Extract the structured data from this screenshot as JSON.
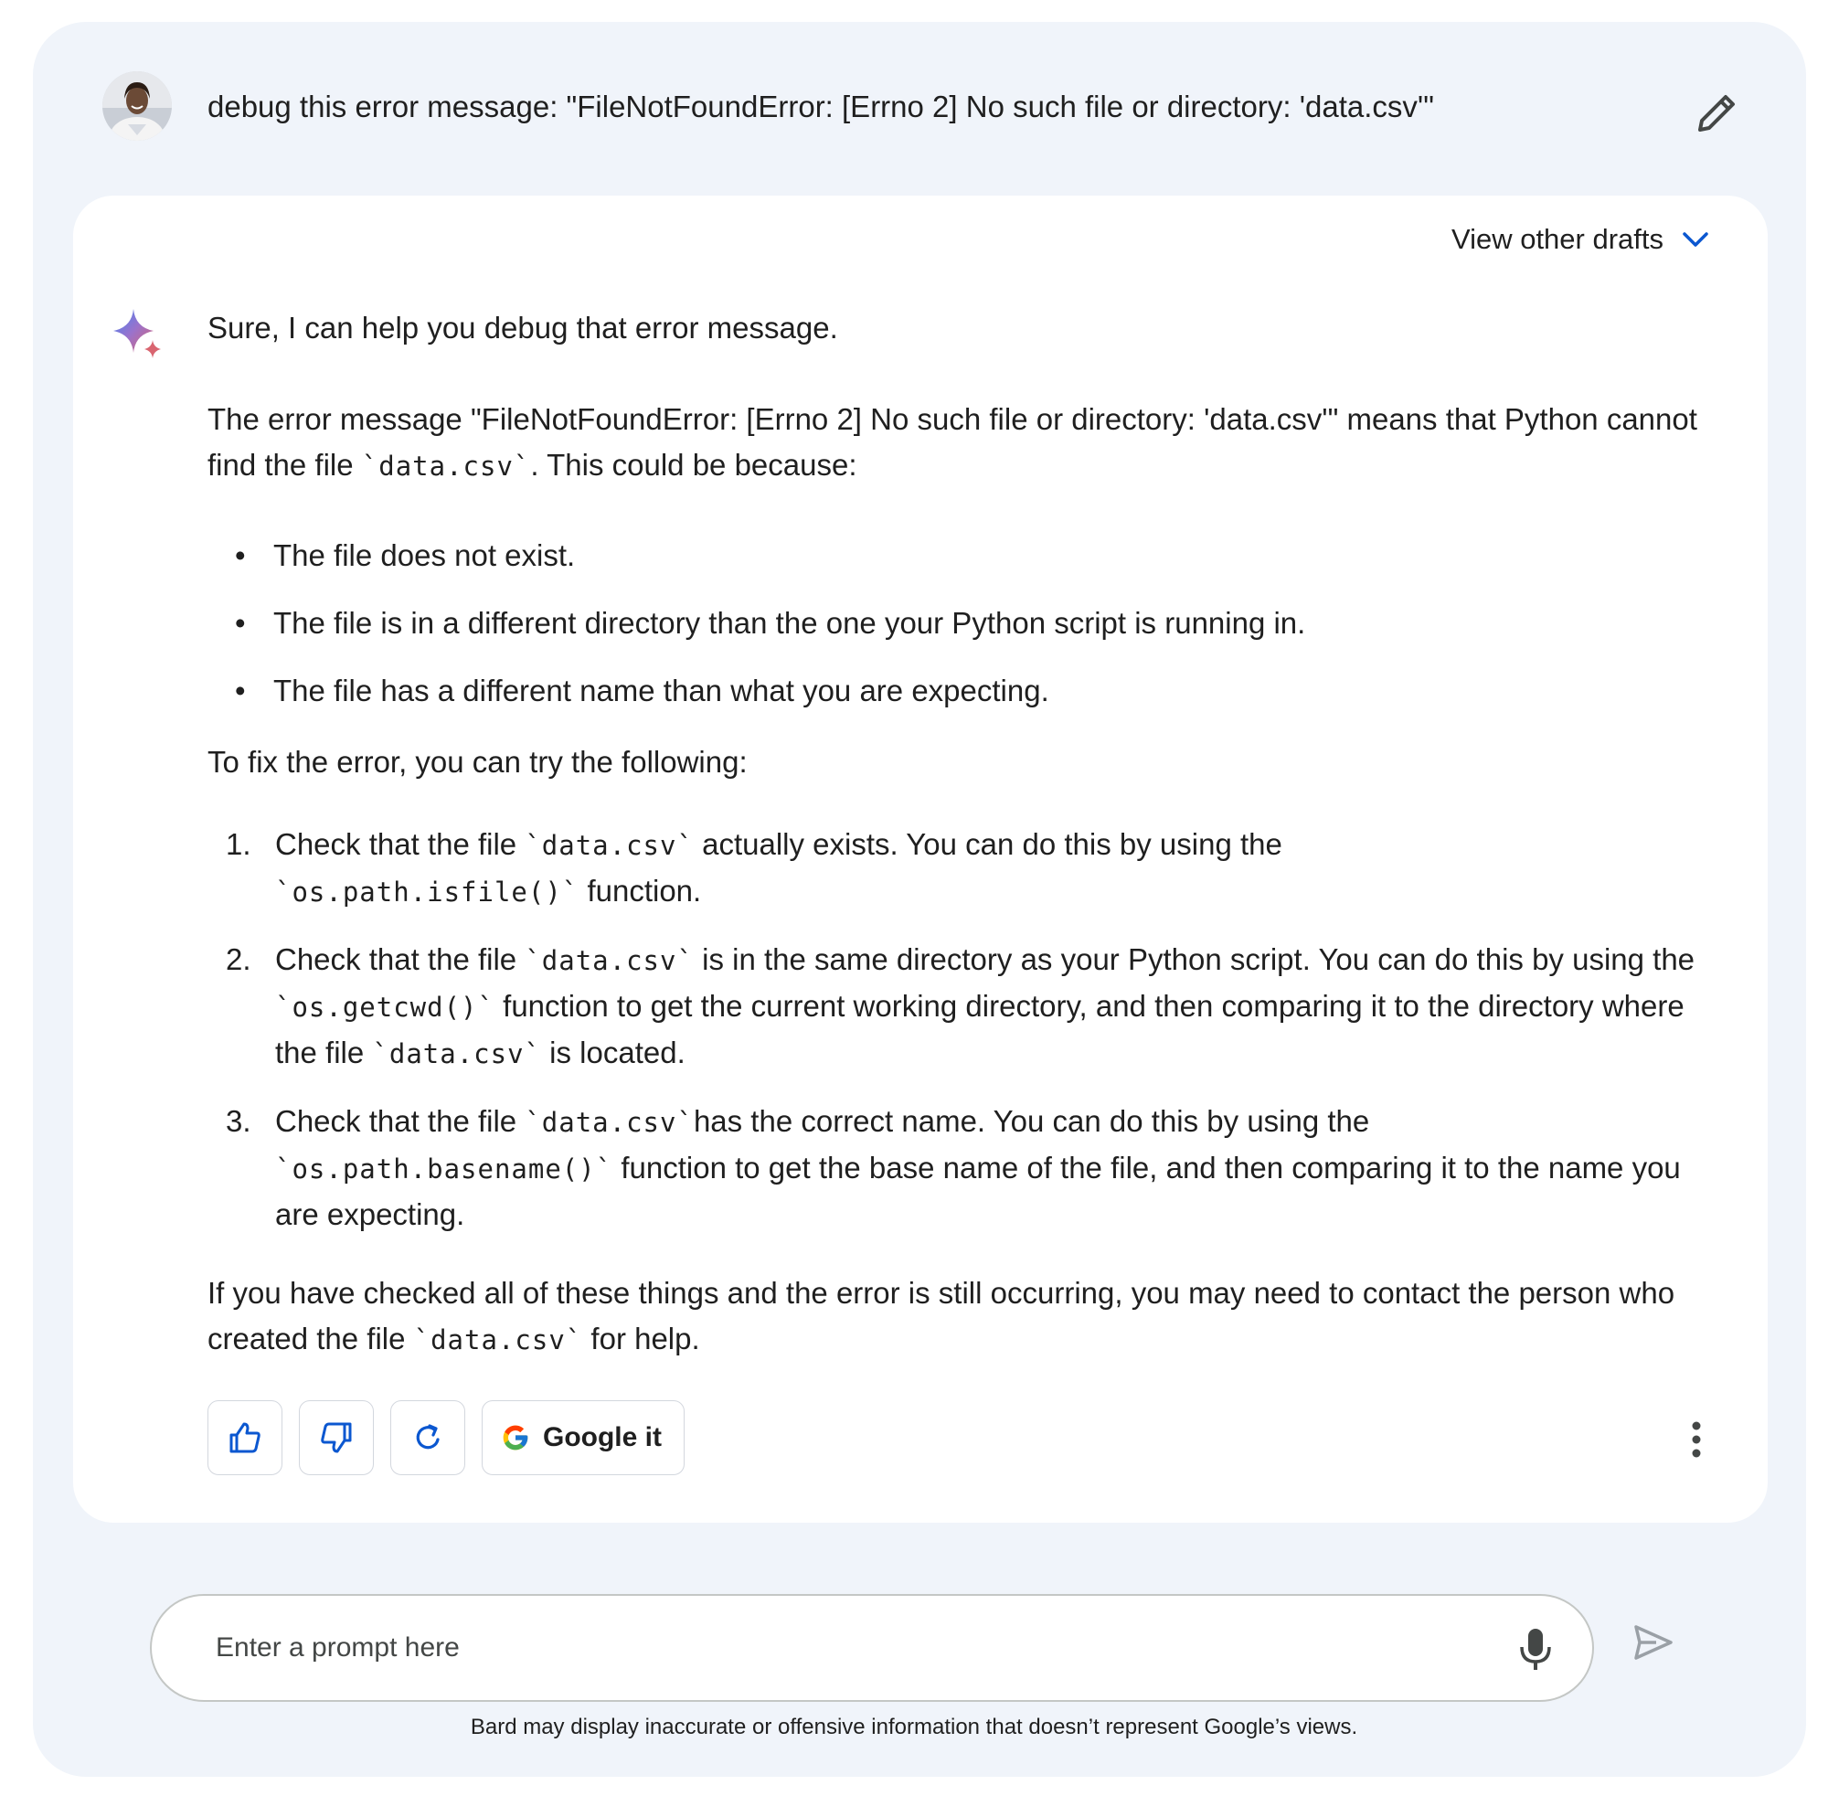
{
  "user": {
    "prompt": "debug this error message: \"FileNotFoundError: [Errno 2] No such file or directory: 'data.csv'\""
  },
  "response": {
    "view_drafts_label": "View other drafts",
    "intro": "Sure, I can help you debug that error message.",
    "explanation_a": "The error message \"FileNotFoundError: [Errno 2] No such file or directory: 'data.csv'\" means that Python cannot find the file ",
    "explanation_code": "`data.csv`",
    "explanation_b": ". This could be because:",
    "reasons": [
      "The file does not exist.",
      "The file is in a different directory than the one your Python script is running in.",
      "The file has a different name than what you are expecting."
    ],
    "fix_intro": "To fix the error, you can try the following:",
    "steps": [
      {
        "num": "1.",
        "t1": "Check that the file ",
        "c1": "`data.csv`",
        "t2": " actually exists. You can do this by using the ",
        "c2": "`os.path.isfile()`",
        "t3": " function."
      },
      {
        "num": "2.",
        "t1": "Check that the file ",
        "c1": "`data.csv`",
        "t2": " is in the same directory as your Python script. You can do this by using the ",
        "c2": "`os.getcwd()`",
        "t3": " function to get the current working directory, and then comparing it to the directory where the file ",
        "c3": "`data.csv`",
        "t4": " is located."
      },
      {
        "num": "3.",
        "t1": "Check that the file ",
        "c1": "`data.csv`",
        "t2": "has the correct name. You can do this by using the ",
        "c2": "`os.path.basename()`",
        "t3": " function to get the base name of the file, and then comparing it to the name you are expecting."
      }
    ],
    "closing_a": "If you have checked all of these things and the error is still occurring, you may need to contact the person who created the file ",
    "closing_code": "`data.csv`",
    "closing_b": " for help.",
    "actions": {
      "google_it_label": "Google it",
      "icons": [
        "thumbs-up-icon",
        "thumbs-down-icon",
        "regenerate-icon",
        "google-icon",
        "more-vert-icon"
      ]
    }
  },
  "input": {
    "placeholder": "Enter a prompt here",
    "value": ""
  },
  "disclaimer": "Bard may display inaccurate or offensive information that doesn’t represent Google’s views.",
  "colors": {
    "frame_bg": "#f0f4fa",
    "card_bg": "#ffffff",
    "accent_blue": "#0b57d0",
    "text": "#1f1f1f"
  }
}
